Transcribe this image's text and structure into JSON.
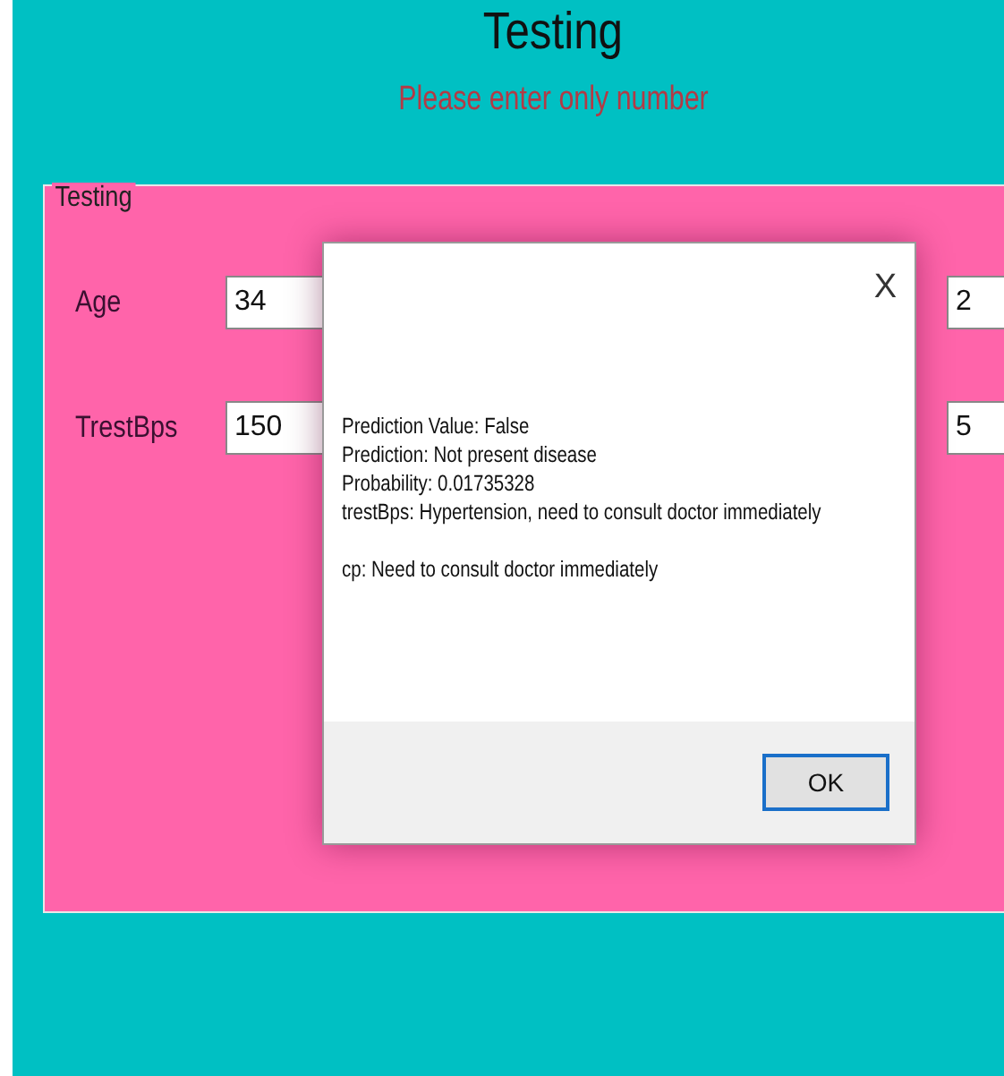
{
  "header": {
    "title": "Testing",
    "hint": "Please enter only number"
  },
  "group": {
    "title": "Testing",
    "fields": [
      {
        "label": "Age",
        "value": "34"
      },
      {
        "label": "TrestBps",
        "value": "150"
      }
    ],
    "right_fields": [
      {
        "value": "2"
      },
      {
        "value": "5"
      }
    ]
  },
  "dialog": {
    "close": "X",
    "lines": [
      "Prediction Value: False",
      "Prediction: Not present disease",
      "Probability: 0.01735328",
      "trestBps: Hypertension, need to consult doctor immediately"
    ],
    "note": "cp: Need to consult doctor immediately",
    "button": "OK"
  }
}
